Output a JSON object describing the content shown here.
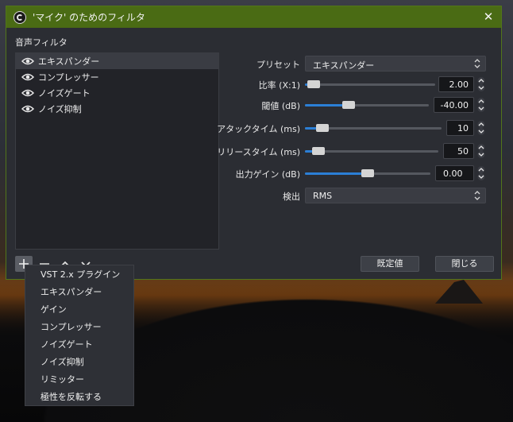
{
  "window": {
    "title": "'マイク' のためのフィルタ"
  },
  "section_label": "音声フィルタ",
  "filters": [
    {
      "label": "エキスパンダー"
    },
    {
      "label": "コンプレッサー"
    },
    {
      "label": "ノイズゲート"
    },
    {
      "label": "ノイズ抑制"
    }
  ],
  "toolbar": {
    "add_icon": "plus-icon",
    "remove_icon": "minus-icon",
    "up_icon": "chevron-up-icon",
    "down_icon": "chevron-down-icon"
  },
  "properties": {
    "preset": {
      "label": "プリセット",
      "value": "エキスパンダー"
    },
    "ratio": {
      "label": "比率 (X:1)",
      "value": "2.00",
      "level": 0.07
    },
    "threshold": {
      "label": "閾値 (dB)",
      "value": "-40.00",
      "level": 0.35
    },
    "attack": {
      "label": "アタックタイム (ms)",
      "value": "10",
      "level": 0.13
    },
    "release": {
      "label": "リリースタイム (ms)",
      "value": "50",
      "level": 0.1
    },
    "output_gain": {
      "label": "出力ゲイン (dB)",
      "value": "0.00",
      "level": 0.5
    },
    "detect": {
      "label": "検出",
      "value": "RMS"
    }
  },
  "buttons": {
    "defaults": "既定値",
    "close": "閉じる"
  },
  "add_menu": [
    "VST 2.x プラグイン",
    "エキスパンダー",
    "ゲイン",
    "コンプレッサー",
    "ノイズゲート",
    "ノイズ抑制",
    "リミッター",
    "極性を反転する"
  ],
  "colors": {
    "titlebar": "#4a6b14",
    "accent": "#2b7fd6",
    "background": "#2b2d33"
  }
}
